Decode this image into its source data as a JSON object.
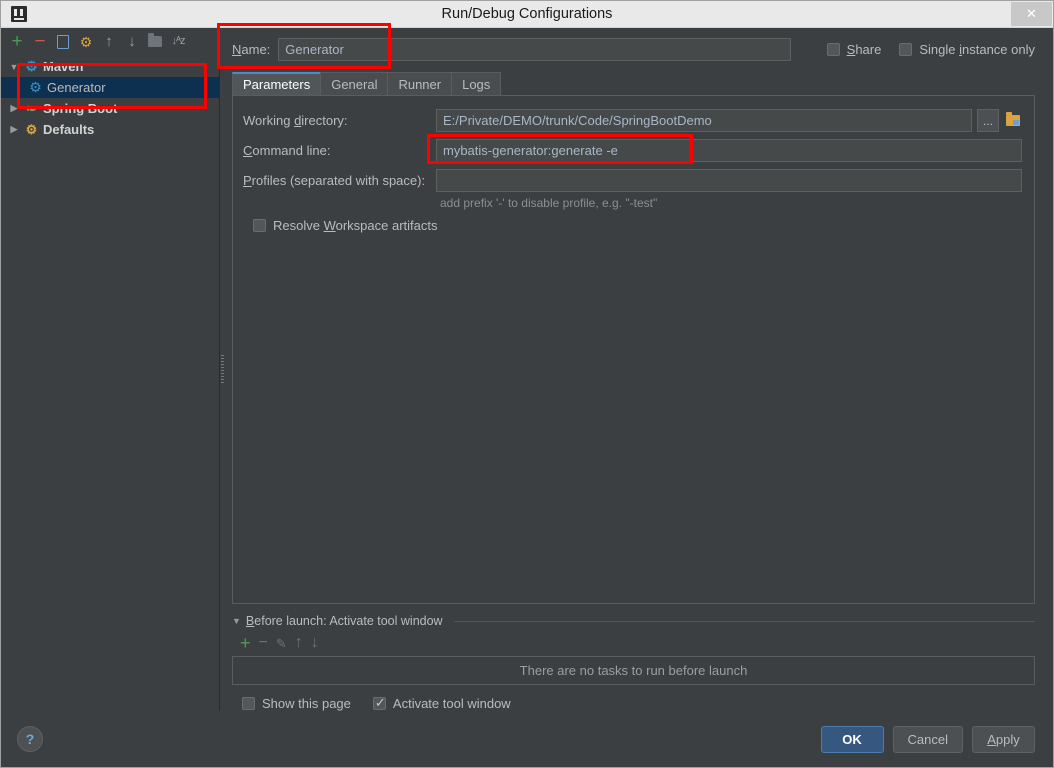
{
  "window": {
    "title": "Run/Debug Configurations",
    "logo_icon": "intellij-idea-logo",
    "close_label": "✕"
  },
  "tree_toolbar": {
    "items": [
      {
        "name": "add",
        "icon": "plus-icon",
        "glyph": "+"
      },
      {
        "name": "remove",
        "icon": "minus-icon",
        "glyph": "−"
      },
      {
        "name": "copy",
        "icon": "copy-icon",
        "glyph": ""
      },
      {
        "name": "edit-defaults",
        "icon": "wrench-icon",
        "glyph": "🔧"
      },
      {
        "name": "move-up",
        "icon": "arrow-up-icon",
        "glyph": "↑"
      },
      {
        "name": "move-down",
        "icon": "arrow-down-icon",
        "glyph": "↓"
      },
      {
        "name": "create-folder",
        "icon": "folder-icon",
        "glyph": ""
      },
      {
        "name": "sort-alphabetically",
        "icon": "sort-az-icon",
        "glyph": "↓ᵃz"
      }
    ]
  },
  "tree": {
    "nodes": [
      {
        "label": "Maven",
        "icon": "gear-icon",
        "expanded": true,
        "bold": true,
        "selected": false,
        "child": false
      },
      {
        "label": "Generator",
        "icon": "gear-icon",
        "expanded": false,
        "bold": false,
        "selected": true,
        "child": true
      },
      {
        "label": "Spring Boot",
        "icon": "leaf-icon",
        "expanded": false,
        "bold": true,
        "selected": false,
        "child": false
      },
      {
        "label": "Defaults",
        "icon": "wrench-icon",
        "expanded": false,
        "bold": true,
        "selected": false,
        "child": false
      }
    ],
    "twisty_expanded": "▼",
    "twisty_collapsed": "▶"
  },
  "name_row": {
    "label_prefix": "",
    "label_accel": "N",
    "label_suffix": "ame:",
    "value": "Generator",
    "share": {
      "accel": "S",
      "suffix": "hare",
      "checked": false
    },
    "single_instance": {
      "prefix": "Single ",
      "accel": "i",
      "suffix": "nstance only",
      "checked": false
    }
  },
  "tabs": [
    {
      "label": "Parameters",
      "active": true
    },
    {
      "label": "General",
      "active": false
    },
    {
      "label": "Runner",
      "active": false
    },
    {
      "label": "Logs",
      "active": false
    }
  ],
  "parameters": {
    "working_directory": {
      "label_prefix": "Working ",
      "label_accel": "d",
      "label_suffix": "irectory:",
      "value": "E:/Private/DEMO/trunk/Code/SpringBootDemo",
      "browse_label": "...",
      "module_icon": "module-folder-icon"
    },
    "command_line": {
      "label_prefix": "",
      "label_accel": "C",
      "label_suffix": "ommand line:",
      "value": "mybatis-generator:generate -e"
    },
    "profiles": {
      "label_prefix": "",
      "label_accel": "P",
      "label_suffix": "rofiles (separated with space):",
      "value": "",
      "hint": "add prefix '-' to disable profile, e.g. \"-test\""
    },
    "resolve_workspace": {
      "prefix": "Resolve ",
      "accel": "W",
      "suffix": "orkspace artifacts",
      "checked": false
    }
  },
  "before_launch": {
    "twisty": "▼",
    "title_accel": "B",
    "title_rest": "efore launch: Activate tool window",
    "toolbar": [
      {
        "name": "add-task",
        "icon": "plus-icon",
        "glyph": "+",
        "enabled": true
      },
      {
        "name": "remove-task",
        "icon": "minus-icon",
        "glyph": "−",
        "enabled": false
      },
      {
        "name": "edit-task",
        "icon": "pencil-icon",
        "glyph": "✎",
        "enabled": false
      },
      {
        "name": "move-task-up",
        "icon": "arrow-up-icon",
        "glyph": "↑",
        "enabled": false
      },
      {
        "name": "move-task-down",
        "icon": "arrow-down-icon",
        "glyph": "↓",
        "enabled": false
      }
    ],
    "empty_text": "There are no tasks to run before launch",
    "show_this_page": {
      "label": "Show this page",
      "checked": false
    },
    "activate_tool_window": {
      "label": "Activate tool window",
      "checked": true
    }
  },
  "footer": {
    "help_label": "?",
    "ok_label": "OK",
    "cancel_label": "Cancel",
    "apply_accel": "A",
    "apply_rest": "pply"
  },
  "annotations": {
    "accent_color": "#ff0000",
    "boxes": [
      {
        "name": "name-field-highlight"
      },
      {
        "name": "maven-generator-tree-highlight"
      },
      {
        "name": "command-line-highlight"
      }
    ]
  }
}
